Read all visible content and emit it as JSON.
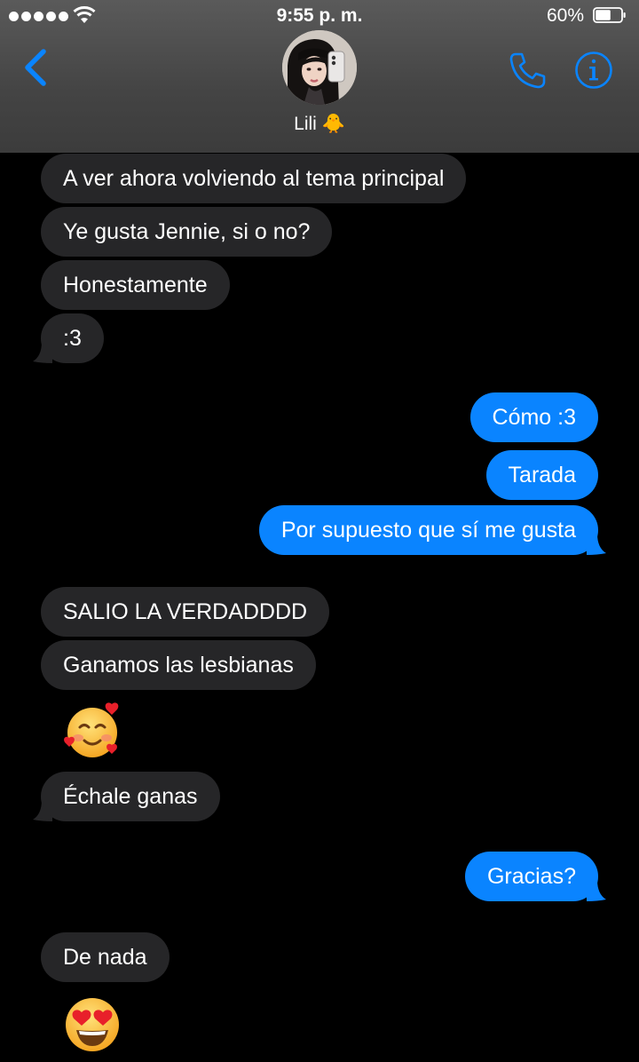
{
  "status_bar": {
    "time": "9:55 p. m.",
    "battery": "60%",
    "battery_level": 0.6
  },
  "header": {
    "contact_name": "Lili 🐥",
    "icons": [
      "back-chevron-icon",
      "phone-icon",
      "info-icon"
    ]
  },
  "messages": [
    {
      "dir": "in",
      "text": "A ver ahora volviendo al tema principal"
    },
    {
      "dir": "in",
      "text": "Ye gusta Jennie, si o no?"
    },
    {
      "dir": "in",
      "text": "Honestamente"
    },
    {
      "dir": "in",
      "text": ":3"
    },
    {
      "dir": "out",
      "text": "Cómo :3"
    },
    {
      "dir": "out",
      "text": "Tarada"
    },
    {
      "dir": "out",
      "text": "Por supuesto que sí me gusta"
    },
    {
      "dir": "in",
      "text": "SALIO LA VERDADDDD"
    },
    {
      "dir": "in",
      "text": "Ganamos las lesbianas"
    },
    {
      "dir": "in",
      "emoji": "smiling-face-with-hearts"
    },
    {
      "dir": "in",
      "text": "Échale ganas"
    },
    {
      "dir": "out",
      "text": "Gracias?"
    },
    {
      "dir": "in",
      "text": "De nada"
    },
    {
      "dir": "in",
      "emoji": "heart-eyes"
    }
  ],
  "colors": {
    "incoming_bubble": "#262628",
    "outgoing_bubble": "#0a84ff",
    "accent": "#0a84ff",
    "background": "#000000"
  }
}
